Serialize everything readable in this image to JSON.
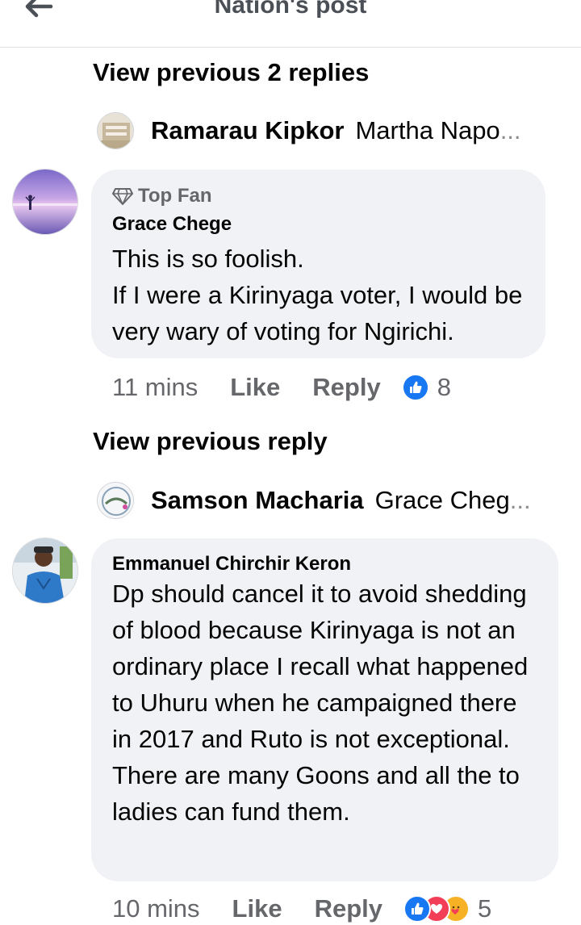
{
  "header": {
    "title": "Nation's post"
  },
  "threads": [
    {
      "view_previous": "View previous 2 replies",
      "reply_preview": {
        "name": "Ramarau Kipkor",
        "text": "Martha Napo",
        "ellipsis": "..."
      },
      "comment": {
        "badge": "Top Fan",
        "author": "Grace Chege",
        "text": "This is so foolish.\nIf I were a Kirinyaga voter, I would be very wary of voting for Ngirichi.",
        "time": "11 mins",
        "like_label": "Like",
        "reply_label": "Reply",
        "reaction_count": "8"
      }
    },
    {
      "view_previous": "View previous reply",
      "reply_preview": {
        "name": "Samson Macharia",
        "text": "Grace Cheg",
        "ellipsis": "..."
      },
      "comment": {
        "author": "Emmanuel Chirchir Keron",
        "text": "Dp should cancel it to avoid shedding of blood because Kirinyaga is not an ordinary place I recall what happened to Uhuru when he campaigned there in 2017 and Ruto is not exceptional.\nThere are many Goons and all the to ladies can fund them.",
        "time": "10 mins",
        "like_label": "Like",
        "reply_label": "Reply",
        "reaction_count": "5"
      }
    }
  ],
  "colors": {
    "like_blue": "#1877f2",
    "love_red": "#f33e58",
    "haha_yellow": "#f7b125",
    "bubble_gray": "#f0f2f5",
    "meta_gray": "#65676b"
  },
  "icons": [
    "back-arrow-icon",
    "diamond-icon",
    "like-reaction-icon",
    "love-reaction-icon",
    "care-reaction-icon"
  ]
}
